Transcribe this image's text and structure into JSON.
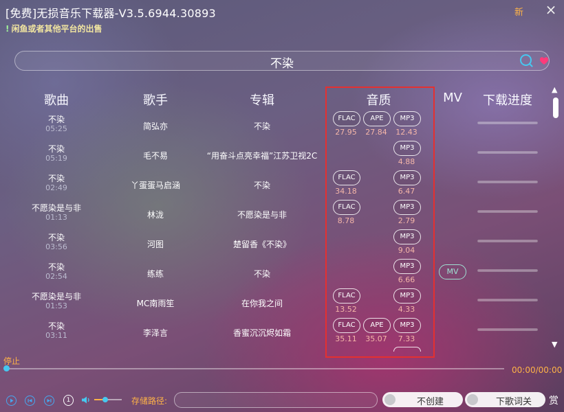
{
  "window": {
    "title": "[免费]无损音乐下载器-V3.5.6944.30893",
    "notice_mark": "!",
    "notice": "闲鱼或者其他平台的出售",
    "new_badge": "新",
    "close_icon": "×"
  },
  "search": {
    "query": "不染",
    "icon": "search-icon",
    "extra_icon": "heart-icon",
    "accent": "#46c8f0"
  },
  "columns": {
    "song": "歌曲",
    "singer": "歌手",
    "album": "专辑",
    "quality": "音质",
    "mv": "MV",
    "progress": "下载进度"
  },
  "rows": [
    {
      "title": "不染",
      "duration": "05:25",
      "singer": "简弘亦",
      "album": "不染",
      "flac": "FLAC",
      "flac_size": "27.95",
      "ape": "APE",
      "ape_size": "27.84",
      "mp3": "MP3",
      "mp3_size": "12.43"
    },
    {
      "title": "不染",
      "duration": "05:19",
      "singer": "毛不易",
      "album": "“用奋斗点亮幸福”江苏卫视2C",
      "mp3": "MP3",
      "mp3_size": "4.88"
    },
    {
      "title": "不染",
      "duration": "02:49",
      "singer": "丫蛋蛋马启涵",
      "album": "不染",
      "flac": "FLAC",
      "flac_size": "34.18",
      "mp3": "MP3",
      "mp3_size": "6.47"
    },
    {
      "title": "不愿染是与非",
      "duration": "01:13",
      "singer": "林泷",
      "album": "不愿染是与非",
      "flac": "FLAC",
      "flac_size": "8.78",
      "mp3": "MP3",
      "mp3_size": "2.79"
    },
    {
      "title": "不染",
      "duration": "03:56",
      "singer": "河图",
      "album": "楚留香《不染》",
      "mp3": "MP3",
      "mp3_size": "9.04"
    },
    {
      "title": "不染",
      "duration": "02:54",
      "singer": "练练",
      "album": "不染",
      "mp3": "MP3",
      "mp3_size": "6.66",
      "mv": "MV"
    },
    {
      "title": "不愿染是与非",
      "duration": "01:53",
      "singer": "MC南雨笙",
      "album": "在你我之间",
      "flac": "FLAC",
      "flac_size": "13.52",
      "mp3": "MP3",
      "mp3_size": "4.33"
    },
    {
      "title": "不染",
      "duration": "03:11",
      "singer": "李泽言",
      "album": "香蜜沉沉烬如霜",
      "flac": "FLAC",
      "flac_size": "35.11",
      "ape": "APE",
      "ape_size": "35.07",
      "mp3": "MP3",
      "mp3_size": "7.33"
    }
  ],
  "player": {
    "status": "停止",
    "time": "00:00/00:00",
    "timer_glyph": "1",
    "volume": 0.4,
    "path_label": "存储路径:",
    "path_value": "",
    "toggle_folder": "不创建",
    "toggle_lyrics": "下歌词关",
    "reward": "赏"
  },
  "colors": {
    "highlight": "#e53030",
    "accent_orange": "#ffb347",
    "mv_color": "#9fe1d3",
    "size_color": "#f5b6a8"
  }
}
